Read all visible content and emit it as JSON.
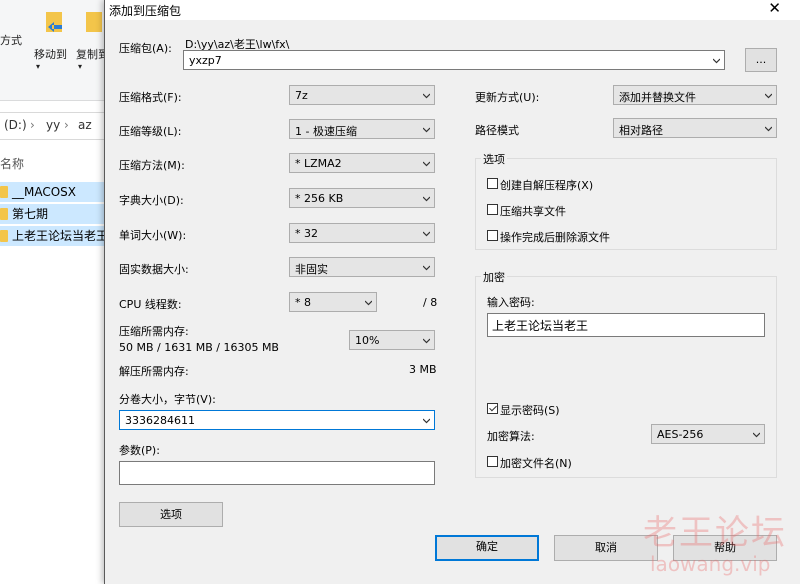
{
  "explorer": {
    "ribbon": {
      "left_cut_label": "方式",
      "move_to_label": "移动到",
      "copy_to_label": "复制到"
    },
    "address": {
      "drive": "(D:)",
      "sep": "›",
      "seg1": "yy",
      "seg2": "az"
    },
    "name_header": "名称",
    "files": [
      {
        "name": "__MACOSX"
      },
      {
        "name": "第七期"
      },
      {
        "name": "上老王论坛当老王"
      }
    ]
  },
  "dialog": {
    "title": "添加到压缩包",
    "close_glyph": "✕",
    "archive": {
      "label": "压缩包(A):",
      "path": "D:\\yy\\az\\老王\\lw\\fx\\",
      "name": "yxzp7",
      "browse_label": "..."
    },
    "left": {
      "format": {
        "label": "压缩格式(F):",
        "value": "7z"
      },
      "level": {
        "label": "压缩等级(L):",
        "value": "1 - 极速压缩"
      },
      "method": {
        "label": "压缩方法(M):",
        "value": "* LZMA2"
      },
      "dict": {
        "label": "字典大小(D):",
        "value": "* 256 KB"
      },
      "word": {
        "label": "单词大小(W):",
        "value": "* 32"
      },
      "solid": {
        "label": "固实数据大小:",
        "value": "非固实"
      },
      "threads": {
        "label": "CPU 线程数:",
        "value": "* 8",
        "max": "/ 8"
      },
      "mem_compress": {
        "label": "压缩所需内存:",
        "detail": "50 MB / 1631 MB / 16305 MB",
        "percent": "10%"
      },
      "mem_decompress": {
        "label": "解压所需内存:",
        "value": "3 MB"
      },
      "volume": {
        "label": "分卷大小，字节(V):",
        "value": "3336284611"
      },
      "params": {
        "label": "参数(P):",
        "value": ""
      },
      "options_button": "选项"
    },
    "right": {
      "update_mode": {
        "label": "更新方式(U):",
        "value": "添加并替换文件"
      },
      "path_mode": {
        "label": "路径模式",
        "value": "相对路径"
      },
      "options_group": {
        "title": "选项",
        "sfx": "创建自解压程序(X)",
        "shared": "压缩共享文件",
        "delete": "操作完成后删除源文件"
      },
      "encryption": {
        "title": "加密",
        "password_label": "输入密码:",
        "password": "上老王论坛当老王",
        "show_password": "显示密码(S)",
        "method_label": "加密算法:",
        "method_value": "AES-256",
        "encrypt_names": "加密文件名(N)"
      }
    },
    "buttons": {
      "ok": "确定",
      "cancel": "取消",
      "help": "帮助"
    }
  },
  "watermark": {
    "text": "老王论坛",
    "url": "laowang.vip"
  }
}
